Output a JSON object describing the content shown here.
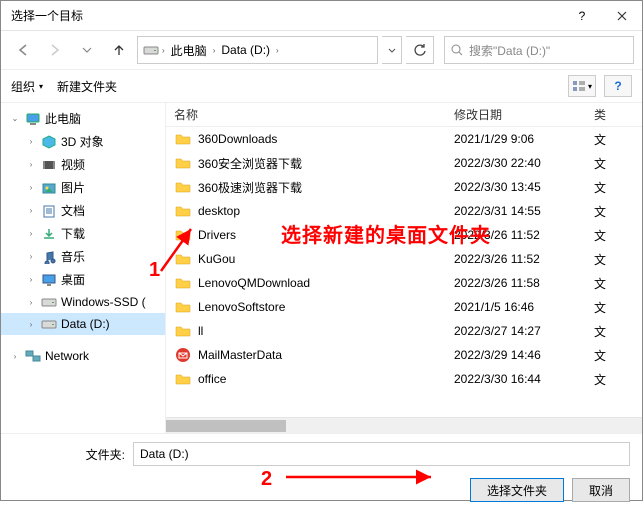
{
  "window": {
    "title": "选择一个目标"
  },
  "breadcrumb": {
    "root": "此电脑",
    "drive": "Data (D:)"
  },
  "search": {
    "placeholder": "搜索\"Data (D:)\""
  },
  "toolbar": {
    "organize": "组织",
    "newfolder": "新建文件夹"
  },
  "tree": {
    "root": "此电脑",
    "nodes": [
      {
        "label": "3D 对象",
        "icon": "3d"
      },
      {
        "label": "视频",
        "icon": "video"
      },
      {
        "label": "图片",
        "icon": "pictures"
      },
      {
        "label": "文档",
        "icon": "docs"
      },
      {
        "label": "下载",
        "icon": "downloads"
      },
      {
        "label": "音乐",
        "icon": "music"
      },
      {
        "label": "桌面",
        "icon": "desktop"
      },
      {
        "label": "Windows-SSD (",
        "icon": "drive"
      },
      {
        "label": "Data (D:)",
        "icon": "drive",
        "selected": true
      }
    ],
    "network": "Network"
  },
  "columns": {
    "name": "名称",
    "date": "修改日期",
    "type": "类"
  },
  "files": [
    {
      "name": "360Downloads",
      "date": "2021/1/29 9:06",
      "type": "文",
      "icon": "folder"
    },
    {
      "name": "360安全浏览器下载",
      "date": "2022/3/30 22:40",
      "type": "文",
      "icon": "folder"
    },
    {
      "name": "360极速浏览器下载",
      "date": "2022/3/30 13:45",
      "type": "文",
      "icon": "folder"
    },
    {
      "name": "desktop",
      "date": "2022/3/31 14:55",
      "type": "文",
      "icon": "folder"
    },
    {
      "name": "Drivers",
      "date": "2022/3/26 11:52",
      "type": "文",
      "icon": "folder"
    },
    {
      "name": "KuGou",
      "date": "2022/3/26 11:52",
      "type": "文",
      "icon": "folder"
    },
    {
      "name": "LenovoQMDownload",
      "date": "2022/3/26 11:58",
      "type": "文",
      "icon": "folder"
    },
    {
      "name": "LenovoSoftstore",
      "date": "2021/1/5 16:46",
      "type": "文",
      "icon": "folder"
    },
    {
      "name": "ll",
      "date": "2022/3/27 14:27",
      "type": "文",
      "icon": "folder"
    },
    {
      "name": "MailMasterData",
      "date": "2022/3/29 14:46",
      "type": "文",
      "icon": "mail"
    },
    {
      "name": "office",
      "date": "2022/3/30 16:44",
      "type": "文",
      "icon": "folder"
    }
  ],
  "footer": {
    "label": "文件夹:",
    "value": "Data (D:)",
    "select": "选择文件夹",
    "cancel": "取消"
  },
  "annotations": {
    "a1": "1",
    "a2": "2",
    "text1": "选择新建的桌面文件夹"
  }
}
